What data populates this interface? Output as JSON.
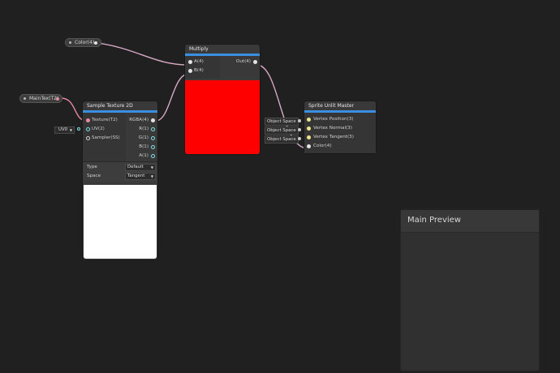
{
  "properties": {
    "color": {
      "label": "Color(4)"
    },
    "maintex": {
      "label": "MainTex(T2)"
    }
  },
  "multiply": {
    "title": "Multiply",
    "inputs": [
      "A(4)",
      "B(4)"
    ],
    "output": "Out(4)",
    "preview_color": "#ff0000"
  },
  "sample_texture": {
    "title": "Sample Texture 2D",
    "inputs": [
      "Texture(T2)",
      "UV(2)",
      "Sampler(SS)"
    ],
    "outputs": [
      "RGBA(4)",
      "R(1)",
      "G(1)",
      "B(1)",
      "A(1)"
    ],
    "uv_dropdown": "UV0",
    "type_label": "Type",
    "type_value": "Default",
    "space_label": "Space",
    "space_value": "Tangent",
    "preview_color": "#ffffff"
  },
  "master": {
    "title": "Sprite Unlit Master",
    "inputs": [
      "Vertex Position(3)",
      "Vertex Normal(3)",
      "Vertex Tangent(3)",
      "Color(4)"
    ],
    "space_tags": [
      "Object Space",
      "Object Space",
      "Object Space"
    ]
  },
  "main_preview": {
    "title": "Main Preview"
  },
  "colors": {
    "accent": "#3a8fe0",
    "background": "#202020",
    "wire": "#d6a9c5"
  }
}
